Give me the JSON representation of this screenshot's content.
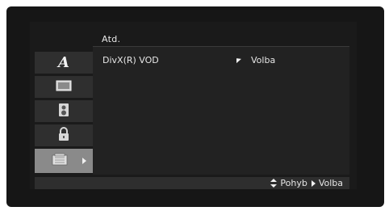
{
  "menu": {
    "title": "Atd."
  },
  "sidebar": {
    "items": [
      {
        "icon": "language-icon",
        "glyph": "A"
      },
      {
        "icon": "display-icon"
      },
      {
        "icon": "audio-speaker-icon"
      },
      {
        "icon": "lock-icon"
      },
      {
        "icon": "others-icon"
      }
    ],
    "active_index": 4
  },
  "settings": {
    "rows": [
      {
        "label": "DivX(R) VOD",
        "value": "Volba"
      }
    ]
  },
  "footer": {
    "move_label": "Pohyb",
    "select_label": "Volba"
  },
  "colors": {
    "background": "#161616",
    "panel": "#222222",
    "sidebar_item": "#2f2f2f",
    "sidebar_active": "#8a8a8a",
    "text": "#e6e6e6"
  }
}
